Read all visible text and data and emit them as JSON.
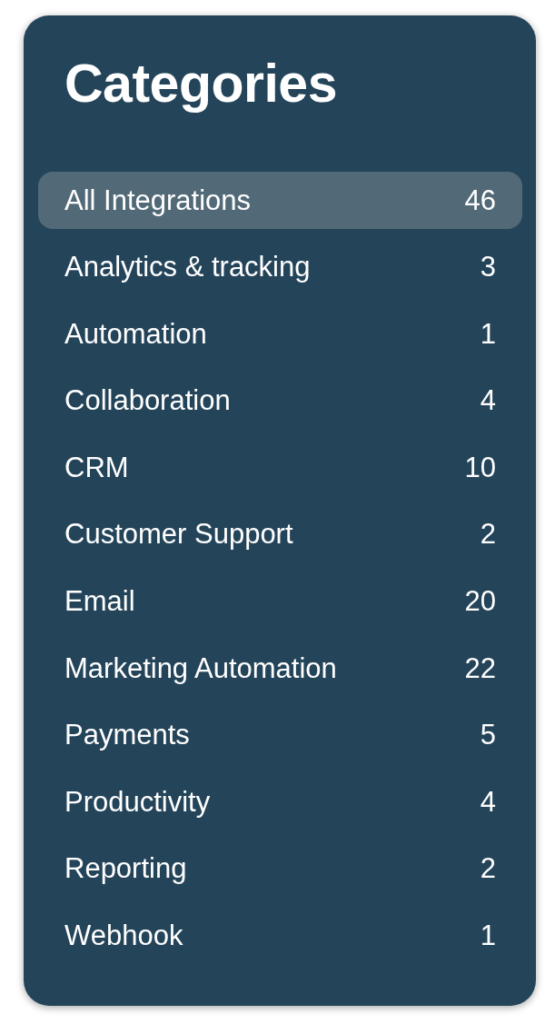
{
  "title": "Categories",
  "categories": [
    {
      "label": "All Integrations",
      "count": "46",
      "selected": true
    },
    {
      "label": "Analytics & tracking",
      "count": "3",
      "selected": false
    },
    {
      "label": "Automation",
      "count": "1",
      "selected": false
    },
    {
      "label": "Collaboration",
      "count": "4",
      "selected": false
    },
    {
      "label": "CRM",
      "count": "10",
      "selected": false
    },
    {
      "label": "Customer Support",
      "count": "2",
      "selected": false
    },
    {
      "label": "Email",
      "count": "20",
      "selected": false
    },
    {
      "label": "Marketing Automation",
      "count": "22",
      "selected": false
    },
    {
      "label": "Payments",
      "count": "5",
      "selected": false
    },
    {
      "label": "Productivity",
      "count": "4",
      "selected": false
    },
    {
      "label": "Reporting",
      "count": "2",
      "selected": false
    },
    {
      "label": "Webhook",
      "count": "1",
      "selected": false
    }
  ]
}
